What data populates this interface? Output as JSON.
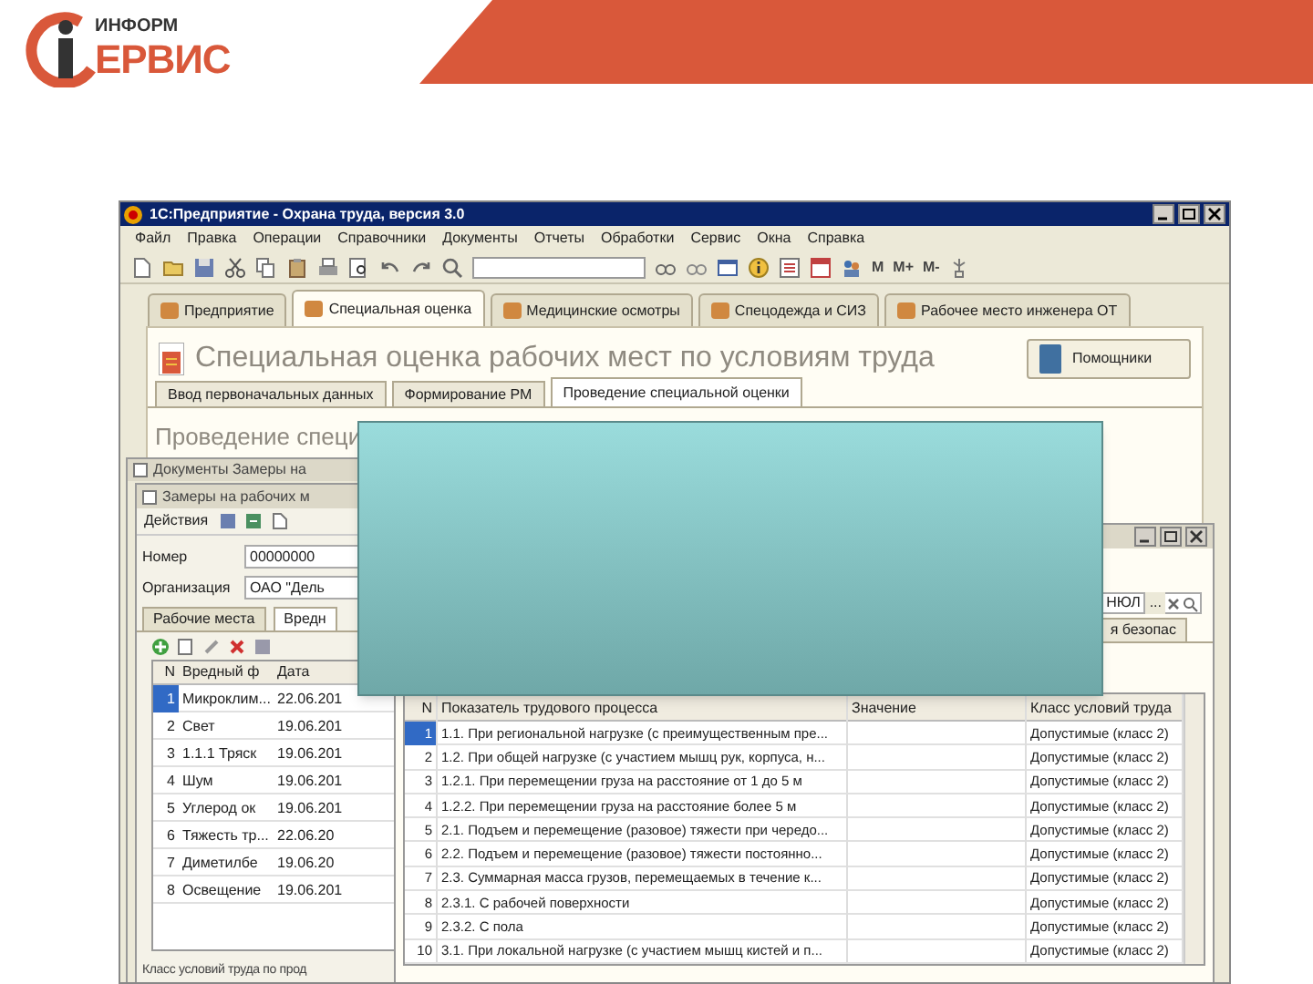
{
  "logo": {
    "small": "ИНФОРМ",
    "large": "ЕРВИС"
  },
  "app": {
    "title": "1С:Предприятие - Охрана труда, версия 3.0",
    "menu": [
      "Файл",
      "Правка",
      "Операции",
      "Справочники",
      "Документы",
      "Отчеты",
      "Обработки",
      "Сервис",
      "Окна",
      "Справка"
    ],
    "toolbar_labels": [
      "M",
      "M+",
      "M-"
    ],
    "section_tabs": [
      {
        "label": "Предприятие",
        "selected": false
      },
      {
        "label": "Специальная оценка",
        "selected": true
      },
      {
        "label": "Медицинские осмотры",
        "selected": false
      },
      {
        "label": "Спецодежда и СИЗ",
        "selected": false
      },
      {
        "label": "Рабочее место инженера ОТ",
        "selected": false
      }
    ],
    "heading": "Специальная оценка рабочих мест по условиям труда",
    "helpers_button": "Помощники",
    "sub_tabs": [
      {
        "label": "Ввод первоначальных данных",
        "selected": false
      },
      {
        "label": "Формирование РМ",
        "selected": false
      },
      {
        "label": "Проведение специальной оценки",
        "selected": true
      }
    ],
    "section_heading": "Проведение специ"
  },
  "documents_window": {
    "title": "Документы Замеры на"
  },
  "measurement_window": {
    "title": "Замеры на рабочих м",
    "actions_button": "Действия",
    "fields": [
      {
        "label": "Номер",
        "value": "00000000"
      },
      {
        "label": "Организация",
        "value": "ОАО \"Дель"
      }
    ],
    "tabs": [
      {
        "label": "Рабочие места",
        "selected": false
      },
      {
        "label": "Вредн",
        "selected": true
      }
    ],
    "table": {
      "columns": [
        "N",
        "Вредный ф",
        "Дата"
      ],
      "rows": [
        {
          "cells": [
            "1",
            "Микроклим...",
            "22.06.201"
          ],
          "selected": true
        },
        {
          "cells": [
            "2",
            "Свет",
            "19.06.201"
          ],
          "selected": false
        },
        {
          "cells": [
            "3",
            "1.1.1 Тряск",
            "19.06.201"
          ],
          "selected": false
        },
        {
          "cells": [
            "4",
            "Шум",
            "19.06.201"
          ],
          "selected": false
        },
        {
          "cells": [
            "5",
            "Углерод ок",
            "19.06.201"
          ],
          "selected": false
        },
        {
          "cells": [
            "6",
            "Тяжесть тр...",
            "22.06.20"
          ],
          "selected": false
        },
        {
          "cells": [
            "7",
            "Диметилбе",
            "19.06.20"
          ],
          "selected": false
        },
        {
          "cells": [
            "8",
            "Освещение",
            "19.06.201"
          ],
          "selected": false
        }
      ]
    },
    "footer_label": "Класс условий труда по прод"
  },
  "factors_window": {
    "field_value": "НЮЛ",
    "field_button": "...",
    "tab": "я безопас",
    "table": {
      "columns": [
        "N",
        "Показатель трудового процесса",
        "Значение",
        "Класс условий труда"
      ],
      "rows": [
        {
          "cells": [
            "1",
            "1.1. При региональной нагрузке (с преимущественным пре...",
            "",
            "Допустимые (класс 2)"
          ],
          "selected": true
        },
        {
          "cells": [
            "2",
            "1.2. При общей нагрузке (с участием мышц рук, корпуса, н...",
            "",
            "Допустимые (класс 2)"
          ],
          "selected": false
        },
        {
          "cells": [
            "3",
            "1.2.1. При перемещении груза на расстояние от 1 до 5 м",
            "",
            "Допустимые (класс 2)"
          ],
          "selected": false
        },
        {
          "cells": [
            "4",
            "1.2.2. При перемещении груза на расстояние более 5 м",
            "",
            "Допустимые (класс 2)"
          ],
          "selected": false
        },
        {
          "cells": [
            "5",
            "2.1. Подъем и перемещение (разовое) тяжести при чередо...",
            "",
            "Допустимые (класс 2)"
          ],
          "selected": false
        },
        {
          "cells": [
            "6",
            "2.2. Подъем и перемещение (разовое) тяжести постоянно...",
            "",
            "Допустимые (класс 2)"
          ],
          "selected": false
        },
        {
          "cells": [
            "7",
            "2.3. Суммарная масса грузов, перемещаемых в течение к...",
            "",
            "Допустимые (класс 2)"
          ],
          "selected": false
        },
        {
          "cells": [
            "8",
            "2.3.1. С рабочей поверхности",
            "",
            "Допустимые (класс 2)"
          ],
          "selected": false
        },
        {
          "cells": [
            "9",
            "2.3.2. С пола",
            "",
            "Допустимые (класс 2)"
          ],
          "selected": false
        },
        {
          "cells": [
            "10",
            "3.1. При локальной нагрузке (с участием мышц кистей и п...",
            "",
            "Допустимые (класс 2)"
          ],
          "selected": false
        }
      ]
    }
  }
}
